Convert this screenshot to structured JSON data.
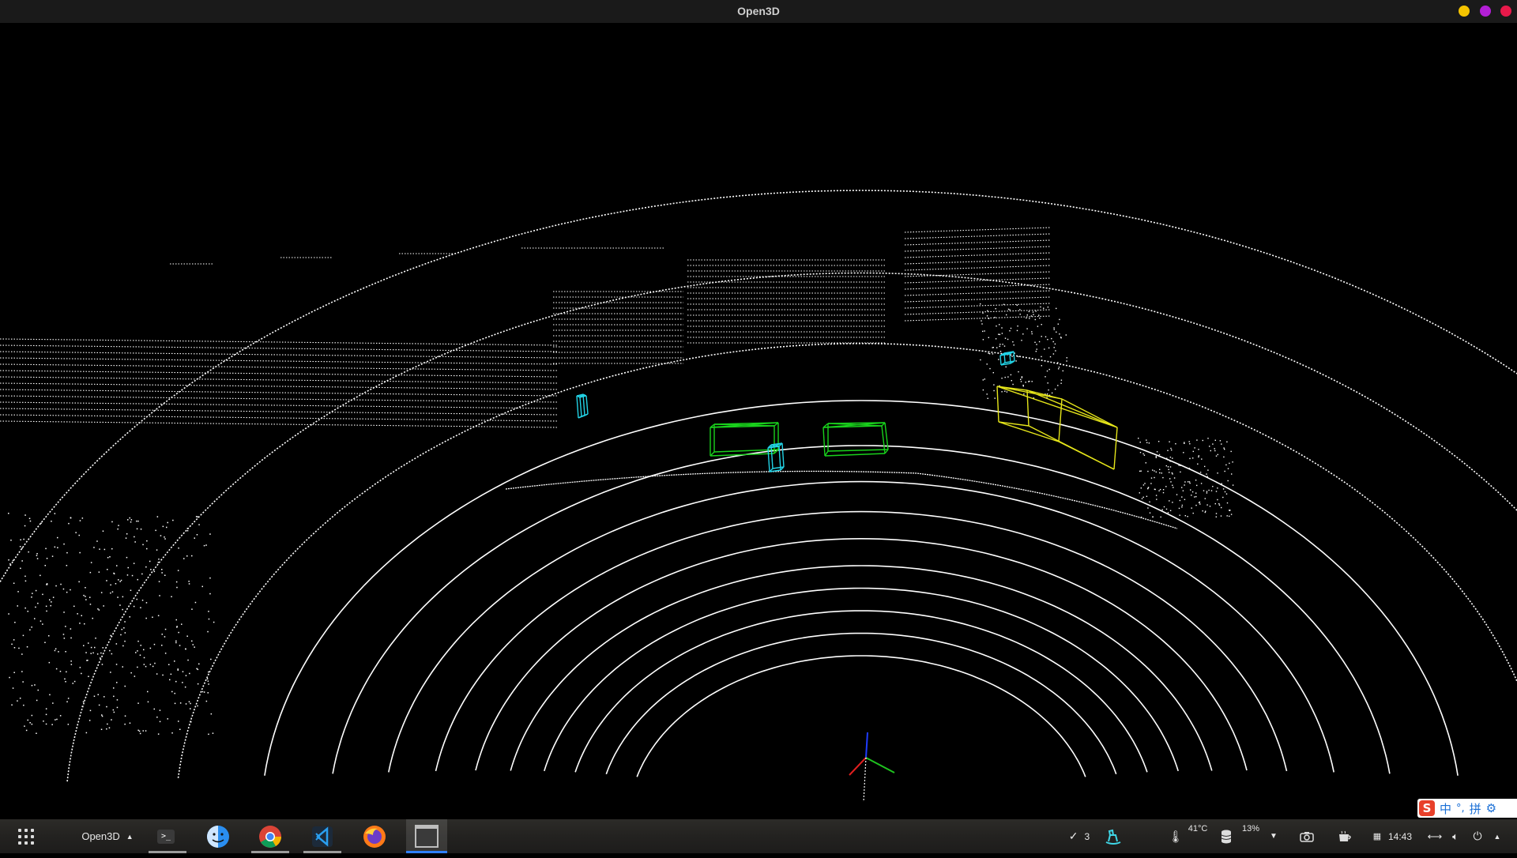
{
  "window": {
    "title": "Open3D"
  },
  "window_buttons": [
    {
      "name": "minimize",
      "color": "#f5c400"
    },
    {
      "name": "maximize",
      "color": "#b31fd6"
    },
    {
      "name": "close",
      "color": "#e8194a"
    }
  ],
  "scene": {
    "background": "#000000",
    "point_color": "#ffffff",
    "boxes": [
      {
        "name": "pedestrian-box-left",
        "color": "#22d3e6"
      },
      {
        "name": "car-box-center-left",
        "color": "#19d11c"
      },
      {
        "name": "pedestrian-box-center",
        "color": "#22d3e6"
      },
      {
        "name": "car-box-center-right",
        "color": "#19d11c"
      },
      {
        "name": "truck-box-right",
        "color": "#e6e61a"
      },
      {
        "name": "pedestrian-box-right",
        "color": "#22d3e6"
      }
    ],
    "axes": [
      {
        "name": "z-axis",
        "color": "#1f3cff"
      },
      {
        "name": "y-axis",
        "color": "#1fc21f"
      },
      {
        "name": "x-axis",
        "color": "#e01f1f"
      }
    ]
  },
  "taskbar": {
    "active_app_label": "Open3D",
    "apps": [
      {
        "name": "terminal-icon",
        "label": ">_"
      },
      {
        "name": "finder-icon"
      },
      {
        "name": "chrome-icon"
      },
      {
        "name": "vscode-icon"
      },
      {
        "name": "firefox-icon"
      },
      {
        "name": "open3d-window-icon"
      }
    ],
    "tray": {
      "tasks_count": "3",
      "temperature": "41°C",
      "disk_usage": "13%",
      "clock": "14:43"
    }
  },
  "ime": {
    "mode": "中",
    "punct": "°,",
    "pinyin": "拼"
  }
}
